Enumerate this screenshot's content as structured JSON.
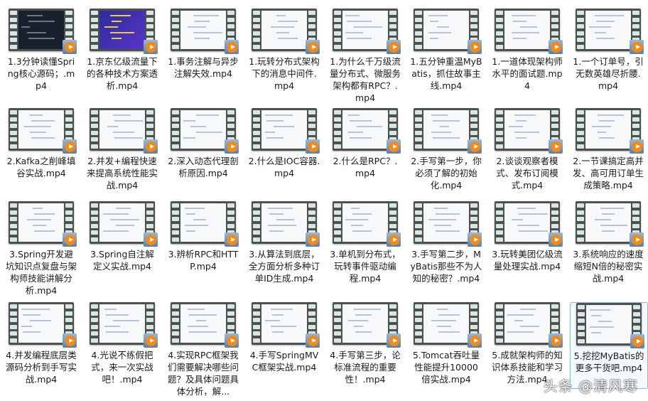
{
  "files": [
    {
      "name": "1.3分钟读懂Spring核心源码；.mp4",
      "screen": "dark"
    },
    {
      "name": "1.京东亿级流量下的各种技术方案透析.mp4",
      "screen": "blue"
    },
    {
      "name": "1.事务注解与异步注解失效.mp4",
      "screen": "light"
    },
    {
      "name": "1.玩转分布式架构下的消息中间件.mp4",
      "screen": "light"
    },
    {
      "name": "1.为什么千万级流量分布式、微服务架构都有RPC？.mp4",
      "screen": "light"
    },
    {
      "name": "1.五分钟重温MyBatis，抓住故事主线.mp4",
      "screen": "light"
    },
    {
      "name": "1.一道体现架构师水平的面试题.mp4",
      "screen": "light"
    },
    {
      "name": "1.一个订单号，引无数英雄尽折腰.mp4",
      "screen": "light"
    },
    {
      "name": "2.Kafka之削峰填谷实战.mp4",
      "screen": "light"
    },
    {
      "name": "2.并发+编程快速来提高系统性能实战.mp4",
      "screen": "light"
    },
    {
      "name": "2.深入动态代理剖析原因.mp4",
      "screen": "light"
    },
    {
      "name": "2.什么是IOC容器.mp4",
      "screen": "light"
    },
    {
      "name": "2.什么是RPC？.mp4",
      "screen": "light"
    },
    {
      "name": "2.手写第一步，你必须了解的初始化.mp4",
      "screen": "light"
    },
    {
      "name": "2.谈谈观察者模式、发布订阅模式.mp4",
      "screen": "light"
    },
    {
      "name": "2.一节课搞定高并发、高可用订单生成策略.mp4",
      "screen": "light"
    },
    {
      "name": "3.Spring开发避坑知识点复盘与架构师技能讲解分析.mp4",
      "screen": "light"
    },
    {
      "name": "3.Spring自注解定义实战.mp4",
      "screen": "light"
    },
    {
      "name": "3.辨析RPC和HTTP.mp4",
      "screen": "light"
    },
    {
      "name": "3.从算法到底层，全方面分析多种订单ID生成.mp4",
      "screen": "light"
    },
    {
      "name": "3.单机到分布式，玩转事件驱动编程.mp4",
      "screen": "light"
    },
    {
      "name": "3.手写第二步，MyBatis那些不为人知的秘密？.mp4",
      "screen": "light"
    },
    {
      "name": "3.玩转美团亿级流量处理实战.mp4",
      "screen": "light"
    },
    {
      "name": "3.系统响应的速度缩短N倍的秘密实战.mp4",
      "screen": "light"
    },
    {
      "name": "4.并发编程底层类源码分析到手写实战.mp4",
      "screen": "light"
    },
    {
      "name": "4.光说不练假把式，来一次实战吧！.mp4",
      "screen": "light"
    },
    {
      "name": "4.实现RPC框架我们需要解决哪些问题？及具体问题具体分析，解...",
      "screen": "light"
    },
    {
      "name": "4.手写SpringMVC框架实战.mp4",
      "screen": "light"
    },
    {
      "name": "4.手写第三步，论标准流程的重要性！.mp4",
      "screen": "light"
    },
    {
      "name": "5.Tomcat吞吐量性能提升10000倍实战.mp4",
      "screen": "light"
    },
    {
      "name": "5.成就架构师的知识体系技能和学习方法.mp4",
      "screen": "light"
    },
    {
      "name": "5.挖挖MyBatis的更多干货吧.mp4",
      "screen": "light",
      "selected": true
    }
  ],
  "watermark": "头条 @清风寒"
}
